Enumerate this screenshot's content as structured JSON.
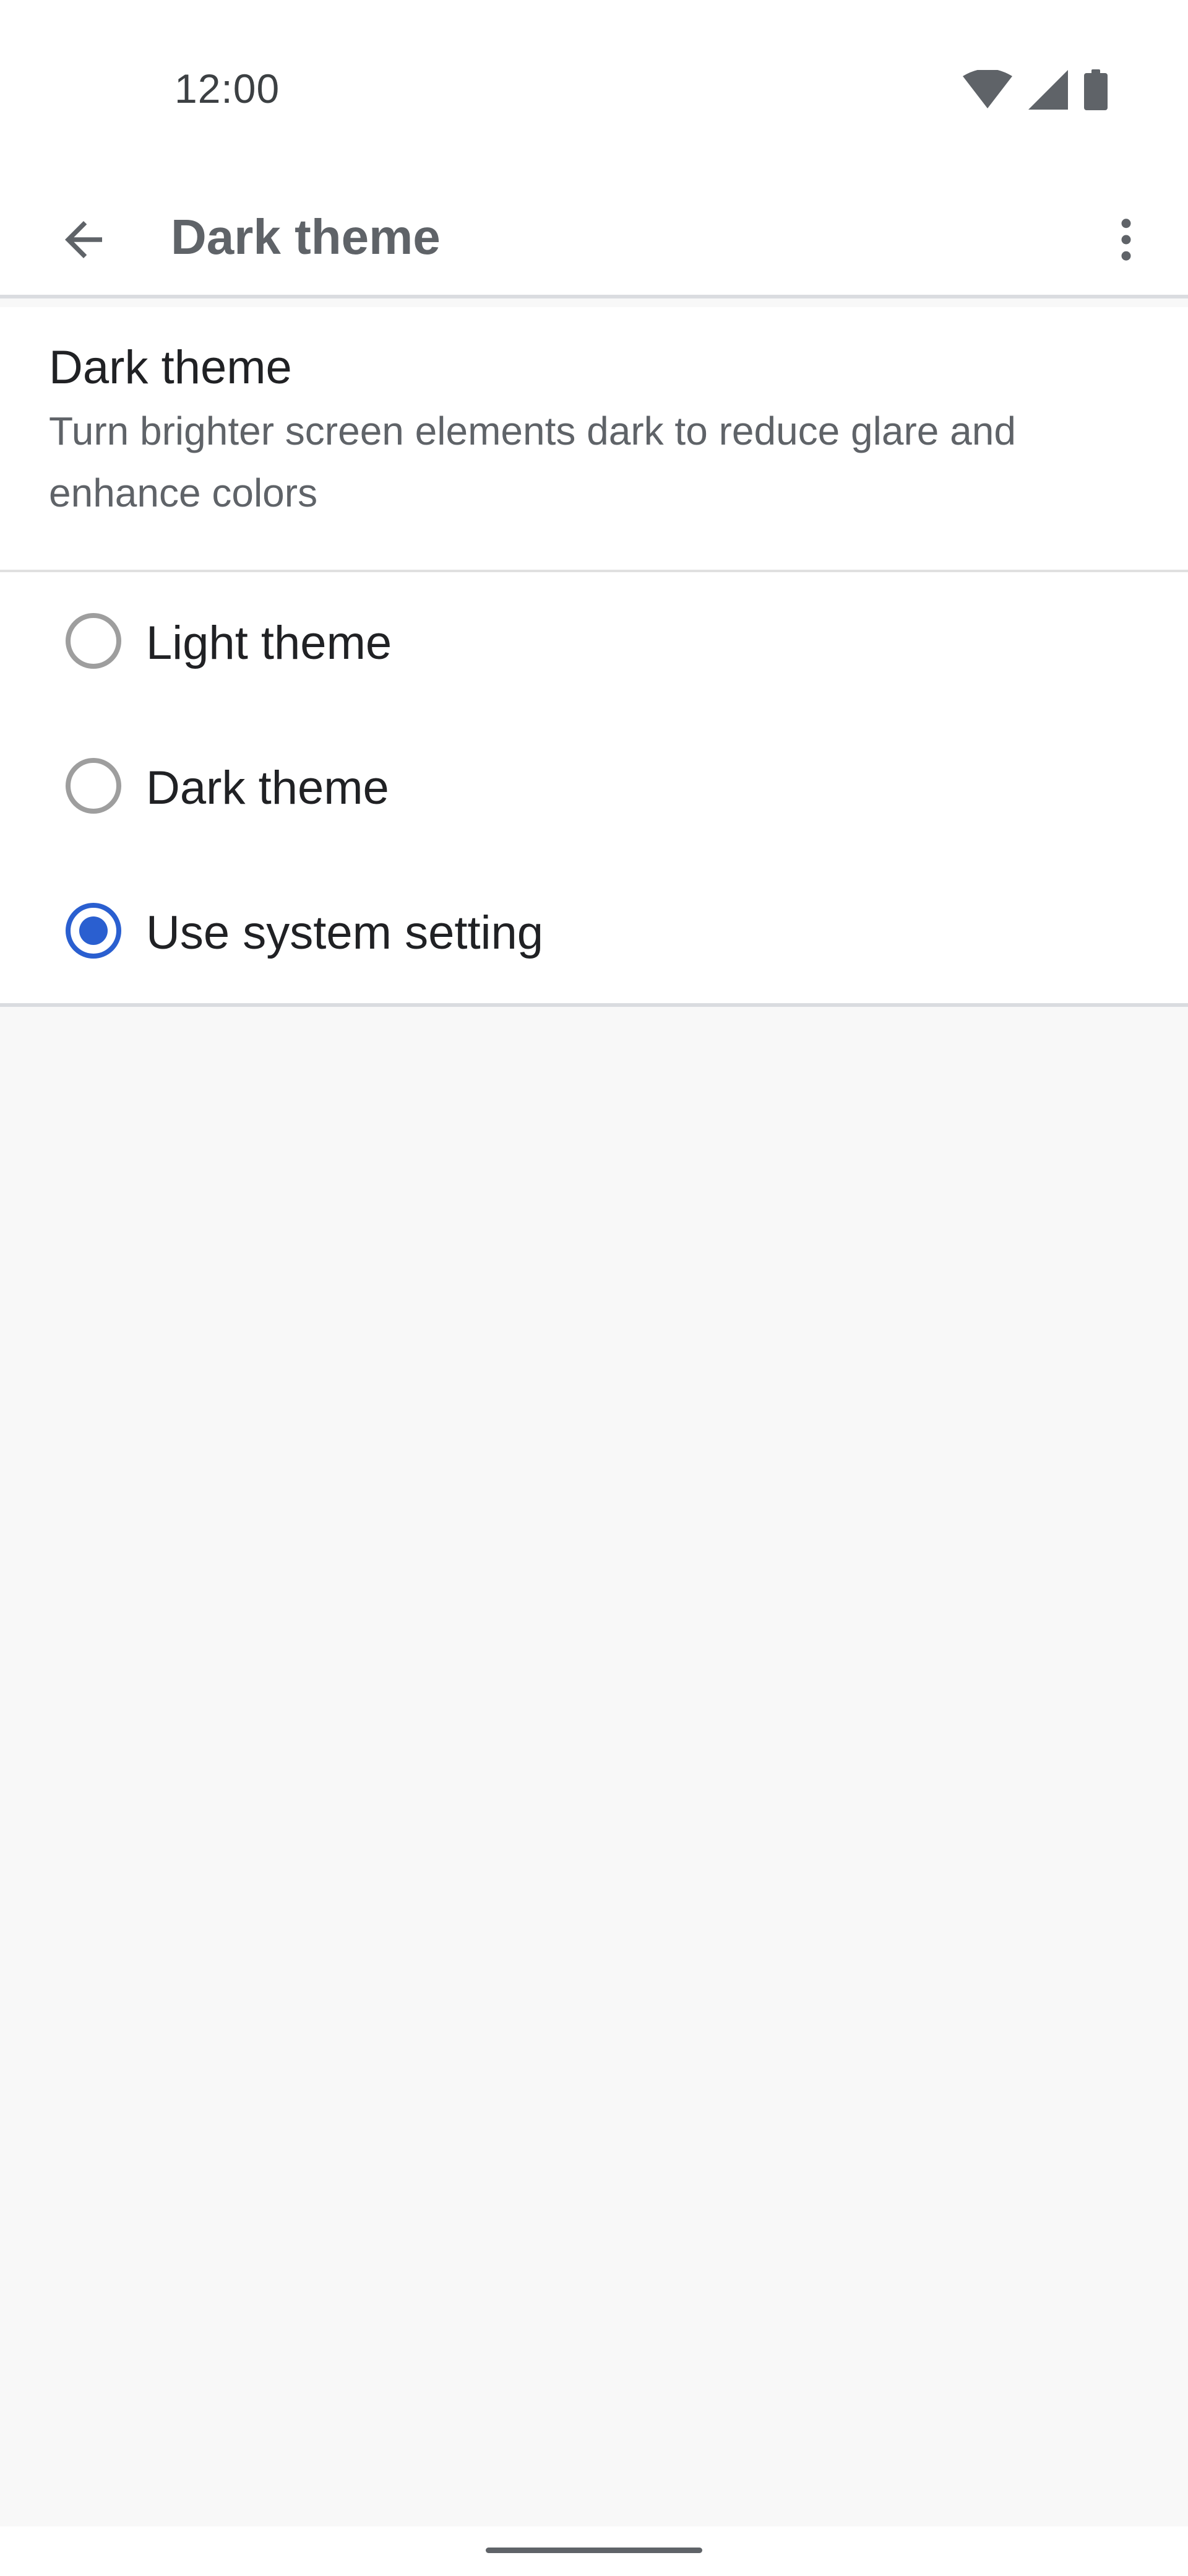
{
  "status_bar": {
    "time": "12:00",
    "icons": [
      "wifi-icon",
      "cell-signal-icon",
      "battery-icon"
    ]
  },
  "toolbar": {
    "title": "Dark theme",
    "back_icon": "arrow-back-icon",
    "overflow_icon": "more-vert-icon"
  },
  "preference": {
    "title": "Dark theme",
    "summary": "Turn brighter screen elements dark to reduce glare and enhance colors"
  },
  "options": [
    {
      "label": "Light theme",
      "checked": false
    },
    {
      "label": "Dark theme",
      "checked": false
    },
    {
      "label": "Use system setting",
      "checked": true
    }
  ],
  "colors": {
    "accent": "#2a5fd0",
    "background": "#f8f8f8",
    "surface": "#ffffff",
    "text_primary": "#202124",
    "text_secondary": "#5f6368"
  }
}
